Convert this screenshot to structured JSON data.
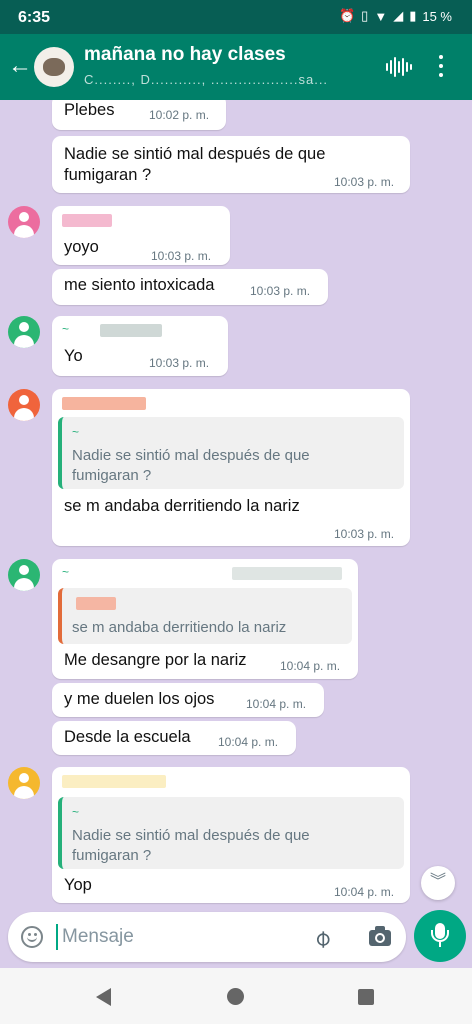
{
  "status_bar": {
    "time": "6:35",
    "battery": "15 %"
  },
  "header": {
    "title": "mañana no hay clases",
    "subtitle": "C........, D..........., ...................sa..."
  },
  "messages": [
    {
      "text": "Plebes",
      "time": "10:02 p. m."
    },
    {
      "text": "Nadie se sintió mal después de que fumigaran ?",
      "time": "10:03 p. m."
    },
    {
      "text": "yoyo",
      "time": "10:03 p. m."
    },
    {
      "text": "me siento intoxicada",
      "time": "10:03 p. m."
    },
    {
      "sender_prefix": "~",
      "text": "Yo",
      "time": "10:03 p. m."
    },
    {
      "quote_text": "Nadie se sintió mal después de que fumigaran ?",
      "quote_name": "~",
      "text": "se m andaba derritiendo la nariz",
      "time": "10:03 p. m."
    },
    {
      "sender_prefix": "~",
      "quote_text": "se m andaba derritiendo la nariz",
      "text": "Me desangre por la nariz",
      "time": "10:04 p. m."
    },
    {
      "text": "y me duelen los ojos",
      "time": "10:04 p. m."
    },
    {
      "text": "Desde la escuela",
      "time": "10:04 p. m."
    },
    {
      "quote_text": "Nadie se sintió mal después de que fumigaran ?",
      "quote_name": "~",
      "text": "Yop",
      "time": "10:04 p. m."
    }
  ],
  "composer": {
    "placeholder": "Mensaje"
  },
  "colors": {
    "header": "#008069",
    "status_bar": "#075e54",
    "accent": "#00a884",
    "chat_bg": "#d9cdea",
    "avatar_pink": "#ec6d9f",
    "avatar_green": "#2bb673",
    "avatar_orange": "#f0643c",
    "avatar_yellow": "#f5b82e"
  },
  "icons": [
    "back-arrow-icon",
    "voice-call-icon",
    "more-menu-icon",
    "emoji-icon",
    "attach-icon",
    "camera-icon",
    "mic-icon",
    "scroll-down-icon"
  ]
}
